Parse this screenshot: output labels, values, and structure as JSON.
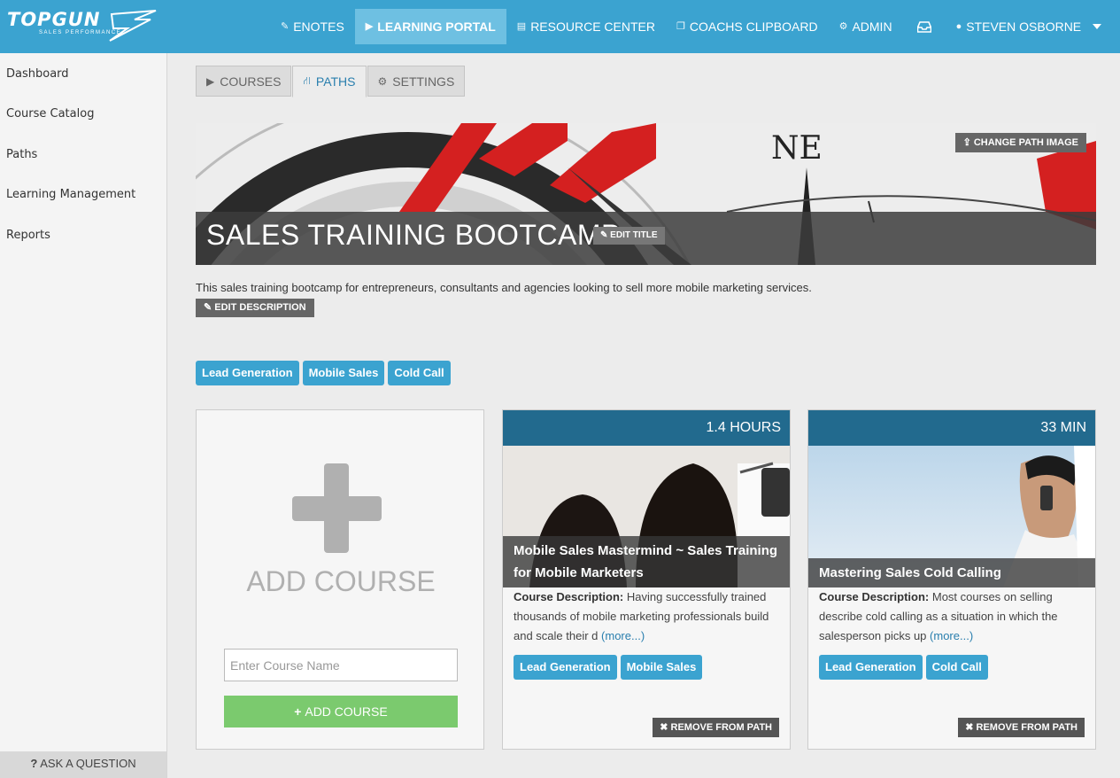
{
  "brand": {
    "logo_text": "TOPGUN",
    "logo_sub": "SALES PERFORMANCE"
  },
  "nav": {
    "items": [
      {
        "label": "ENOTES",
        "icon": "pencil-icon"
      },
      {
        "label": "LEARNING PORTAL",
        "icon": "play-circle-icon"
      },
      {
        "label": "RESOURCE CENTER",
        "icon": "document-icon"
      },
      {
        "label": "COACHS CLIPBOARD",
        "icon": "copy-icon"
      },
      {
        "label": "ADMIN",
        "icon": "cogs-icon"
      },
      {
        "label": "",
        "icon": "inbox-icon"
      },
      {
        "label": "STEVEN OSBORNE",
        "icon": "user-icon"
      }
    ],
    "active": "LEARNING PORTAL"
  },
  "sidebar": {
    "items": [
      "Dashboard",
      "Course Catalog",
      "Paths",
      "Learning Management",
      "Reports"
    ],
    "ask_label": "ASK A QUESTION"
  },
  "tabs": [
    {
      "label": "COURSES",
      "icon": "play-circle-icon"
    },
    {
      "label": "PATHS",
      "icon": "road-icon"
    },
    {
      "label": "SETTINGS",
      "icon": "gear-icon"
    }
  ],
  "active_tab": "PATHS",
  "path": {
    "title": "SALES TRAINING BOOTCAMP",
    "edit_title_label": "EDIT TITLE",
    "change_image_label": "CHANGE PATH IMAGE",
    "description": "This sales training bootcamp for entrepreneurs, consultants and agencies looking to sell more mobile marketing services.",
    "edit_description_label": "EDIT DESCRIPTION",
    "tags": [
      "Lead Generation",
      "Mobile Sales",
      "Cold Call"
    ]
  },
  "add_course": {
    "title": "ADD COURSE",
    "input_placeholder": "Enter Course Name",
    "button_label": "ADD COURSE"
  },
  "courses": [
    {
      "duration": "1.4 HOURS",
      "title": "Mobile Sales Mastermind ~ Sales Training for Mobile Marketers",
      "description_label": "Course Description:",
      "description": "Having successfully trained thousands of mobile marketing professionals build and scale their d",
      "more_label": "(more...)",
      "tags": [
        "Lead Generation",
        "Mobile Sales"
      ],
      "remove_label": "REMOVE FROM PATH"
    },
    {
      "duration": "33 MIN",
      "title": "Mastering Sales Cold Calling",
      "description_label": "Course Description:",
      "description": "Most courses on selling describe cold calling as a situation in which the salesperson picks up",
      "more_label": "(more...)",
      "tags": [
        "Lead Generation",
        "Cold Call"
      ],
      "remove_label": "REMOVE FROM PATH"
    }
  ]
}
